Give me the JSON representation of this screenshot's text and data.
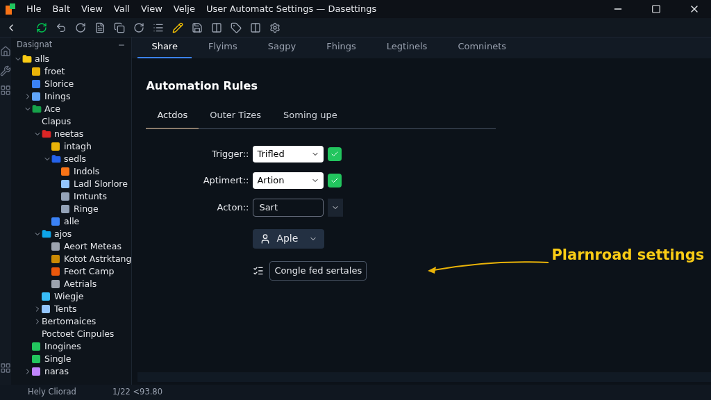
{
  "window": {
    "menus": [
      "Hle",
      "Balt",
      "View",
      "Vall",
      "View",
      "Velje"
    ],
    "title": "User Automatc Settings — Dasettings"
  },
  "sidebar": {
    "title": "Dasignat",
    "tree": [
      {
        "label": "alls",
        "color": "#facc15",
        "expanded": true,
        "children": [
          {
            "label": "froet",
            "color": "#eab308"
          },
          {
            "label": "Slorice",
            "color": "#3b82f6"
          },
          {
            "label": "Inings",
            "color": "#60a5fa",
            "expanded": false
          },
          {
            "label": "Ace",
            "color": "#16a34a",
            "expanded": true,
            "children": [
              {
                "label": "Clapus"
              },
              {
                "label": "neetas",
                "color": "#dc2626",
                "expanded": true,
                "children": [
                  {
                    "label": "intagh",
                    "color": "#eab308"
                  },
                  {
                    "label": "sedls",
                    "color": "#2563eb",
                    "expanded": true,
                    "children": [
                      {
                        "label": "Indols",
                        "color": "#f97316"
                      },
                      {
                        "label": "Ladl Slorlore",
                        "color": "#93c5fd"
                      },
                      {
                        "label": "Imtunts",
                        "color": "#94a3b8"
                      },
                      {
                        "label": "Ringe",
                        "color": "#94a3b8"
                      }
                    ]
                  },
                  {
                    "label": "alle",
                    "color": "#3b82f6"
                  }
                ]
              },
              {
                "label": "ajos",
                "color": "#0ea5e9",
                "expanded": true,
                "children": [
                  {
                    "label": "Aeort Meteas",
                    "color": "#9ca3af"
                  },
                  {
                    "label": "Kotot Astrktang",
                    "color": "#ca8a04"
                  },
                  {
                    "label": "Feort Camp",
                    "color": "#ea580c"
                  },
                  {
                    "label": "Aetrials",
                    "color": "#9ca3af"
                  }
                ]
              },
              {
                "label": "Wiegje",
                "color": "#38bdf8"
              },
              {
                "label": "Tents",
                "color": "#93c5fd",
                "expanded": false
              },
              {
                "label": "Bertomaices",
                "expanded": false
              },
              {
                "label": "Poctoet Cinpules"
              }
            ]
          },
          {
            "label": "Inogines",
            "color": "#22c55e"
          },
          {
            "label": "Single",
            "color": "#22c55e"
          },
          {
            "label": "naras",
            "color": "#c084fc",
            "expanded": false
          }
        ]
      }
    ]
  },
  "tabs": [
    {
      "label": "Share",
      "selected": true
    },
    {
      "label": "Flyims",
      "selected": false
    },
    {
      "label": "Sagpy",
      "selected": false
    },
    {
      "label": "Fhings",
      "selected": false
    },
    {
      "label": "Legtinels",
      "selected": false
    },
    {
      "label": "Comninets",
      "selected": false
    }
  ],
  "heading": "Automation Rules",
  "subtabs": [
    {
      "label": "Actdos",
      "selected": true
    },
    {
      "label": "Outer Tizes",
      "selected": false
    },
    {
      "label": "Soming upe",
      "selected": false
    }
  ],
  "fields": [
    {
      "kind": "select",
      "label": "Trigger::",
      "value": "Trifled",
      "checked": true
    },
    {
      "kind": "select",
      "label": "Aptimert::",
      "value": "Artion",
      "checked": true
    },
    {
      "kind": "input",
      "label": "Acton::",
      "value": "Sart"
    }
  ],
  "apply_button": "Aple",
  "configure_button": "Congle fed sertales",
  "callout": "Plarnroad settings",
  "status_bar": {
    "left": "Hely Cliorad",
    "right": "1/22 <93.80"
  }
}
